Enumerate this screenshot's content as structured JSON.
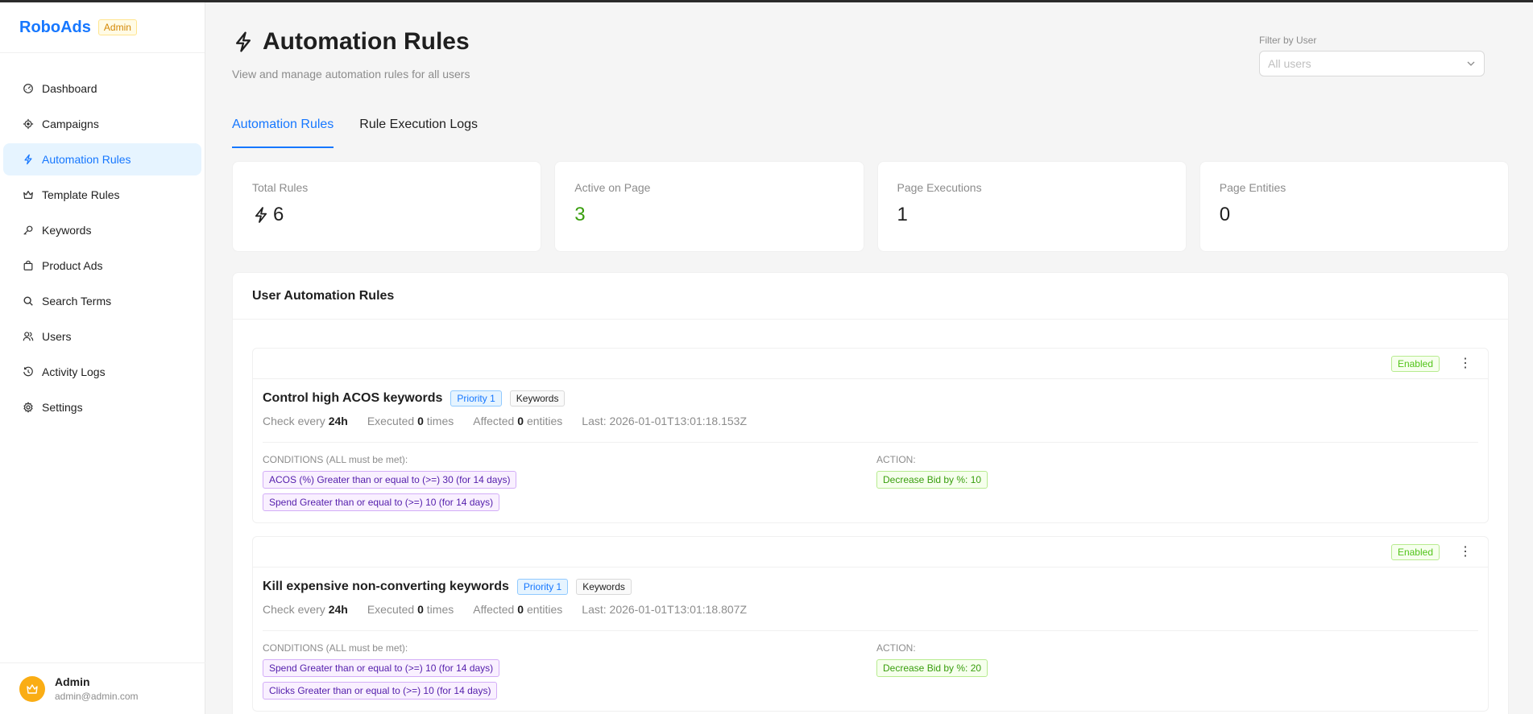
{
  "brand": {
    "name": "RoboAds",
    "badge": "Admin"
  },
  "nav": [
    {
      "label": "Dashboard",
      "icon": "dashboard-icon"
    },
    {
      "label": "Campaigns",
      "icon": "target-icon"
    },
    {
      "label": "Automation Rules",
      "icon": "lightning-icon",
      "active": true
    },
    {
      "label": "Template Rules",
      "icon": "crown-icon"
    },
    {
      "label": "Keywords",
      "icon": "key-icon"
    },
    {
      "label": "Product Ads",
      "icon": "shopping-icon"
    },
    {
      "label": "Search Terms",
      "icon": "search-icon"
    },
    {
      "label": "Users",
      "icon": "users-icon"
    },
    {
      "label": "Activity Logs",
      "icon": "history-icon"
    },
    {
      "label": "Settings",
      "icon": "gear-icon"
    }
  ],
  "user": {
    "name": "Admin",
    "email": "admin@admin.com"
  },
  "header": {
    "title": "Automation Rules",
    "subtitle": "View and manage automation rules for all users",
    "filter_label": "Filter by User",
    "filter_placeholder": "All users"
  },
  "tabs": [
    {
      "label": "Automation Rules",
      "active": true
    },
    {
      "label": "Rule Execution Logs"
    }
  ],
  "stats": [
    {
      "label": "Total Rules",
      "value": "6"
    },
    {
      "label": "Active on Page",
      "value": "3"
    },
    {
      "label": "Page Executions",
      "value": "1"
    },
    {
      "label": "Page Entities",
      "value": "0"
    }
  ],
  "panel_title": "User Automation Rules",
  "rules": [
    {
      "status": "Enabled",
      "title": "Control high ACOS keywords",
      "priority": "Priority 1",
      "type": "Keywords",
      "check_prefix": "Check every",
      "check_value": "24h",
      "executed_prefix": "Executed",
      "executed_value": "0",
      "executed_suffix": "times",
      "affected_prefix": "Affected",
      "affected_value": "0",
      "affected_suffix": "entities",
      "last": "Last: 2026-01-01T13:01:18.153Z",
      "conditions_label": "CONDITIONS (ALL must be met):",
      "conditions": [
        "ACOS (%) Greater than or equal to (>=) 30 (for 14 days)",
        "Spend Greater than or equal to (>=) 10 (for 14 days)"
      ],
      "action_label": "ACTION:",
      "action": "Decrease Bid by %: 10"
    },
    {
      "status": "Enabled",
      "title": "Kill expensive non-converting keywords",
      "priority": "Priority 1",
      "type": "Keywords",
      "check_prefix": "Check every",
      "check_value": "24h",
      "executed_prefix": "Executed",
      "executed_value": "0",
      "executed_suffix": "times",
      "affected_prefix": "Affected",
      "affected_value": "0",
      "affected_suffix": "entities",
      "last": "Last: 2026-01-01T13:01:18.807Z",
      "conditions_label": "CONDITIONS (ALL must be met):",
      "conditions": [
        "Spend Greater than or equal to (>=) 10 (for 14 days)",
        "Clicks Greater than or equal to (>=) 10 (for 14 days)"
      ],
      "action_label": "ACTION:",
      "action": "Decrease Bid by %: 20"
    }
  ],
  "more_glyph": "⋮",
  "colors": {
    "accent": "#1677ff",
    "active_bg": "#e6f4ff",
    "success": "#389e0d",
    "avatar": "#faad14"
  }
}
